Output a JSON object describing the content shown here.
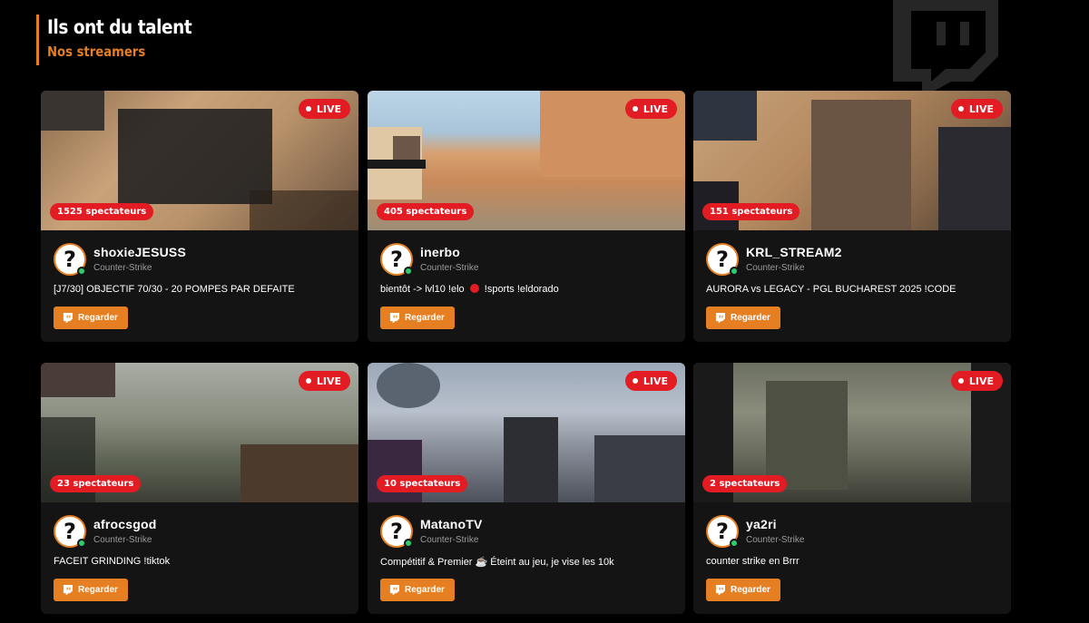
{
  "section": {
    "title": "Ils ont du talent",
    "subtitle": "Nos streamers"
  },
  "brand_icon": "twitch-icon",
  "colors": {
    "accent": "#e67e22",
    "live": "#e31b23",
    "online": "#2ecc71",
    "card": "#141414",
    "background": "#000000"
  },
  "live_label": "LIVE",
  "watch_label": "Regarder",
  "streamers": [
    {
      "name": "shoxieJESUSS",
      "game": "Counter-Strike",
      "viewers": "1525 spectateurs",
      "title": "[J7/30] OBJECTIF 70/30 - 20 POMPES PAR DEFAITE"
    },
    {
      "name": "inerbo",
      "game": "Counter-Strike",
      "viewers": "405 spectateurs",
      "title_before": "bientôt -> lvl10 !elo",
      "title_after": "!sports !eldorado"
    },
    {
      "name": "KRL_STREAM2",
      "game": "Counter-Strike",
      "viewers": "151 spectateurs",
      "title": "AURORA vs LEGACY - PGL BUCHAREST 2025 !CODE"
    },
    {
      "name": "afrocsgod",
      "game": "Counter-Strike",
      "viewers": "23 spectateurs",
      "title": "FACEIT GRINDING !tiktok"
    },
    {
      "name": "MatanoTV",
      "game": "Counter-Strike",
      "viewers": "10 spectateurs",
      "title": "Compétitif & Premier ☕ Éteint au jeu, je vise les 10k"
    },
    {
      "name": "ya2ri",
      "game": "Counter-Strike",
      "viewers": "2 spectateurs",
      "title": "counter strike en Brrr"
    }
  ]
}
